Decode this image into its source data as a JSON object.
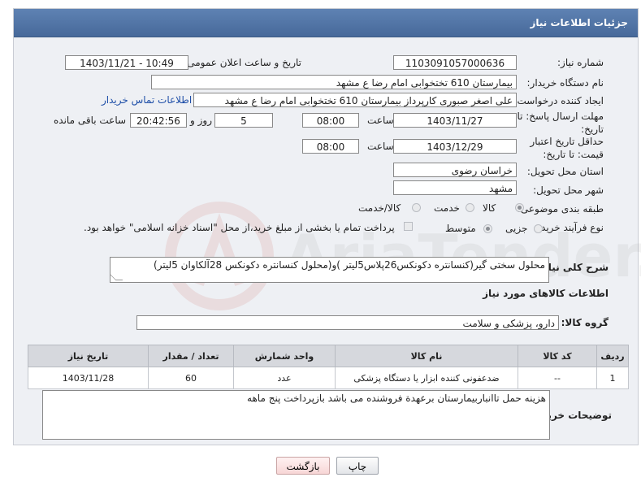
{
  "header": {
    "title": "جزئیات اطلاعات نیاز"
  },
  "fields": {
    "need_number_label": "شماره نیاز:",
    "need_number": "1103091057000636",
    "announce_label": "تاریخ و ساعت اعلان عمومی:",
    "announce_value": "1403/11/21 - 10:49",
    "buyer_org_label": "نام دستگاه خریدار:",
    "buyer_org": "بیمارستان 610 تختخوابی امام رضا ع  مشهد",
    "creator_label": "ایجاد کننده درخواست:",
    "creator": "علی اصغر صبوری کارپرداز بیمارستان 610 تختخوابی امام رضا ع  مشهد",
    "buyer_contact_link": "اطلاعات تماس خریدار",
    "deadline_label": "مهلت ارسال پاسخ: تا تاریخ:",
    "deadline_date": "1403/11/27",
    "time_label": "ساعت",
    "deadline_time": "08:00",
    "days_value": "5",
    "days_label": "روز و",
    "remaining_time": "20:42:56",
    "remaining_label": "ساعت باقی مانده",
    "price_valid_label": "حداقل تاریخ اعتبار قیمت: تا تاریخ:",
    "price_valid_date": "1403/12/29",
    "price_valid_time": "08:00",
    "province_label": "استان محل تحویل:",
    "province": "خراسان رضوی",
    "city_label": "شهر محل تحویل:",
    "city": "مشهد",
    "category_label": "طبقه بندی موضوعی:",
    "category_options": [
      "کالا",
      "خدمت",
      "کالا/خدمت"
    ],
    "process_label": "نوع فرآیند خرید :",
    "process_options": [
      "جزیی",
      "متوسط"
    ],
    "payment_note": "پرداخت تمام یا بخشی از مبلغ خرید،از محل \"اسناد خزانه اسلامی\" خواهد بود."
  },
  "description": {
    "label": "شرح کلی نیاز:",
    "text": "محلول سختی گیر(کنسانتره دکونکس26پلاس5لیتر )و(محلول کنسانتره دکونکس 28آلکاوان 5لیتر)"
  },
  "goods_section": {
    "title": "اطلاعات کالاهای مورد نیاز",
    "group_label": "گروه کالا:",
    "group_value": "دارو، پزشکی و سلامت"
  },
  "table": {
    "headers": [
      "ردیف",
      "کد کالا",
      "نام کالا",
      "واحد شمارش",
      "تعداد / مقدار",
      "تاریخ نیاز"
    ],
    "rows": [
      [
        "1",
        "--",
        "ضدعفونی کننده ابزار یا دستگاه پزشکی",
        "عدد",
        "60",
        "1403/11/28"
      ]
    ]
  },
  "buyer_notes": {
    "label": "توضیحات خریدار:",
    "text": "هزینه حمل تاانباربیمارستان برعهدة فروشنده می باشد بازپرداخت پنج ماهه"
  },
  "buttons": {
    "print": "چاپ",
    "back": "بازگشت"
  },
  "watermark": {
    "text": "AriaTender.neT"
  }
}
